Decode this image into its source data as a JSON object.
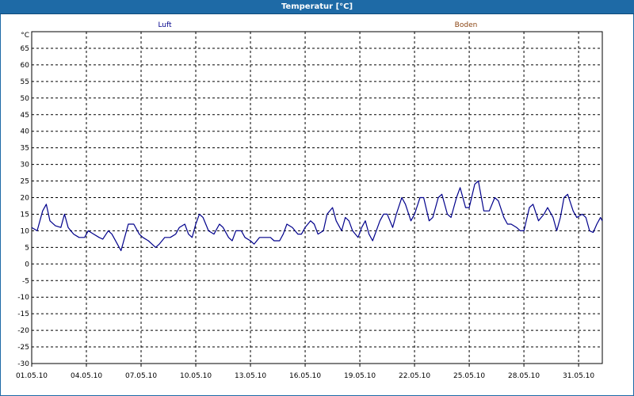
{
  "window": {
    "title": "Temperatur [°C]"
  },
  "chart_data": {
    "type": "line",
    "title": "Temperatur [°C]",
    "ylabel": "°C",
    "ylim": [
      -30,
      70
    ],
    "yticks": [
      65,
      60,
      55,
      50,
      45,
      40,
      35,
      30,
      25,
      20,
      15,
      10,
      5,
      0,
      -5,
      -10,
      -15,
      -20,
      -25,
      -30
    ],
    "xlim": [
      1,
      32.3
    ],
    "xtick_positions": [
      1,
      4,
      7,
      10,
      13,
      16,
      19,
      22,
      25,
      28,
      31
    ],
    "xtick_labels": [
      "01.05.10",
      "04.05.10",
      "07.05.10",
      "10.05.10",
      "13.05.10",
      "16.05.10",
      "19.05.10",
      "22.05.10",
      "25.05.10",
      "28.05.10",
      "31.05.10"
    ],
    "grid": true,
    "legend": [
      {
        "name": "Luft",
        "color": "#00008b"
      },
      {
        "name": "Boden",
        "color": "#8b4513"
      }
    ],
    "series": [
      {
        "name": "Luft",
        "color": "#00008b",
        "points": [
          [
            1.0,
            11
          ],
          [
            1.3,
            10
          ],
          [
            1.6,
            16
          ],
          [
            1.8,
            18
          ],
          [
            2.0,
            13
          ],
          [
            2.3,
            11.5
          ],
          [
            2.6,
            11
          ],
          [
            2.8,
            15
          ],
          [
            3.0,
            11
          ],
          [
            3.3,
            9
          ],
          [
            3.6,
            8
          ],
          [
            3.9,
            8
          ],
          [
            4.1,
            10
          ],
          [
            4.4,
            9
          ],
          [
            4.7,
            8
          ],
          [
            4.9,
            7.5
          ],
          [
            5.2,
            10
          ],
          [
            5.4,
            9
          ],
          [
            5.7,
            6
          ],
          [
            5.9,
            4
          ],
          [
            6.1,
            8
          ],
          [
            6.3,
            12
          ],
          [
            6.6,
            12
          ],
          [
            6.9,
            9
          ],
          [
            7.1,
            8
          ],
          [
            7.4,
            7
          ],
          [
            7.6,
            6
          ],
          [
            7.8,
            5
          ],
          [
            8.0,
            6
          ],
          [
            8.3,
            8
          ],
          [
            8.6,
            8
          ],
          [
            8.9,
            9
          ],
          [
            9.1,
            11
          ],
          [
            9.4,
            12
          ],
          [
            9.6,
            9
          ],
          [
            9.8,
            8
          ],
          [
            10.0,
            12
          ],
          [
            10.2,
            15
          ],
          [
            10.4,
            14
          ],
          [
            10.7,
            10
          ],
          [
            11.0,
            9
          ],
          [
            11.3,
            12
          ],
          [
            11.5,
            11
          ],
          [
            11.8,
            8
          ],
          [
            12.0,
            7
          ],
          [
            12.2,
            10
          ],
          [
            12.5,
            10
          ],
          [
            12.7,
            8
          ],
          [
            13.0,
            7
          ],
          [
            13.2,
            6
          ],
          [
            13.5,
            8
          ],
          [
            13.8,
            8
          ],
          [
            14.1,
            8
          ],
          [
            14.3,
            7
          ],
          [
            14.6,
            7
          ],
          [
            14.8,
            9
          ],
          [
            15.0,
            12
          ],
          [
            15.3,
            11
          ],
          [
            15.6,
            9
          ],
          [
            15.8,
            9
          ],
          [
            16.0,
            11
          ],
          [
            16.3,
            13
          ],
          [
            16.5,
            12
          ],
          [
            16.7,
            9
          ],
          [
            17.0,
            10
          ],
          [
            17.2,
            15
          ],
          [
            17.5,
            17
          ],
          [
            17.7,
            13
          ],
          [
            18.0,
            10
          ],
          [
            18.2,
            14
          ],
          [
            18.4,
            13
          ],
          [
            18.6,
            10
          ],
          [
            18.9,
            8
          ],
          [
            19.1,
            11
          ],
          [
            19.3,
            13
          ],
          [
            19.5,
            9
          ],
          [
            19.7,
            7
          ],
          [
            19.9,
            10
          ],
          [
            20.1,
            13
          ],
          [
            20.3,
            15
          ],
          [
            20.5,
            15
          ],
          [
            20.8,
            11
          ],
          [
            21.0,
            15
          ],
          [
            21.3,
            20
          ],
          [
            21.5,
            18
          ],
          [
            21.8,
            13
          ],
          [
            22.0,
            15
          ],
          [
            22.3,
            20
          ],
          [
            22.5,
            20
          ],
          [
            22.8,
            13
          ],
          [
            23.0,
            14
          ],
          [
            23.3,
            20
          ],
          [
            23.5,
            21
          ],
          [
            23.8,
            15
          ],
          [
            24.0,
            14
          ],
          [
            24.3,
            20
          ],
          [
            24.5,
            23
          ],
          [
            24.8,
            17
          ],
          [
            25.0,
            17
          ],
          [
            25.3,
            24
          ],
          [
            25.5,
            25
          ],
          [
            25.8,
            16
          ],
          [
            26.1,
            16
          ],
          [
            26.4,
            20
          ],
          [
            26.6,
            19
          ],
          [
            26.9,
            14
          ],
          [
            27.1,
            12
          ],
          [
            27.3,
            12
          ],
          [
            27.6,
            11
          ],
          [
            27.8,
            10
          ],
          [
            28.0,
            10
          ],
          [
            28.3,
            17
          ],
          [
            28.5,
            18
          ],
          [
            28.8,
            13
          ],
          [
            29.1,
            15
          ],
          [
            29.3,
            17
          ],
          [
            29.6,
            14
          ],
          [
            29.8,
            10
          ],
          [
            30.0,
            14
          ],
          [
            30.2,
            20
          ],
          [
            30.4,
            21
          ],
          [
            30.7,
            16
          ],
          [
            30.9,
            14
          ],
          [
            31.2,
            15
          ],
          [
            31.4,
            14
          ],
          [
            31.6,
            10
          ],
          [
            31.8,
            9.5
          ],
          [
            32.0,
            12
          ],
          [
            32.2,
            14
          ],
          [
            32.3,
            13
          ]
        ]
      }
    ]
  }
}
